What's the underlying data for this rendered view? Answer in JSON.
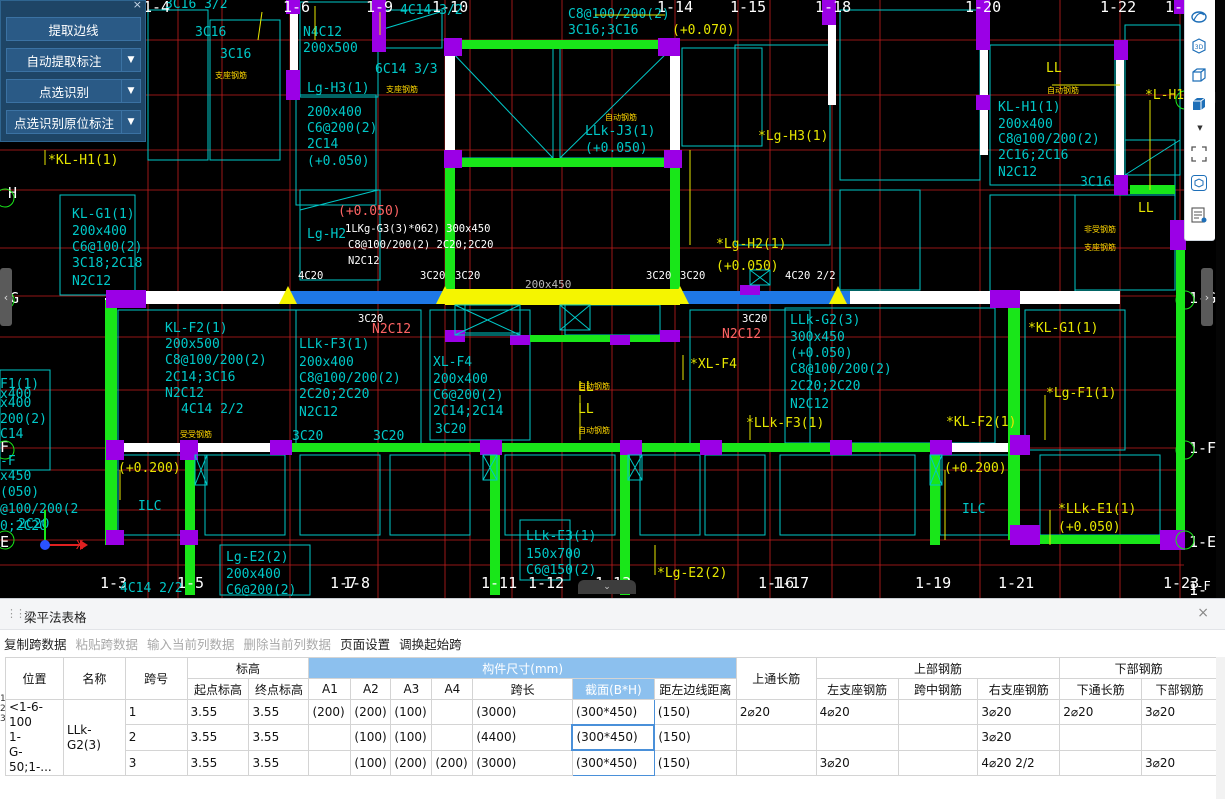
{
  "left_panel": {
    "close_glyph": "×",
    "buttons": [
      {
        "label": "提取边线",
        "has_dropdown": false
      },
      {
        "label": "自动提取标注",
        "has_dropdown": true
      },
      {
        "label": "点选识别",
        "has_dropdown": true
      },
      {
        "label": "点选识别原位标注",
        "has_dropdown": true
      }
    ]
  },
  "right_toolbar": {
    "icons": [
      "orbit-icon",
      "3d-view-icon",
      "cube-view-icon",
      "solid-view-icon",
      "fullscreen-icon",
      "box-select-icon",
      "layer-settings-icon"
    ],
    "label_3d": "3D"
  },
  "cad": {
    "axis_labels_top": [
      "1-4",
      "1-6",
      "1-9",
      "1-10",
      "1-14",
      "1-15",
      "1-18",
      "1-20",
      "1-22",
      "1-24"
    ],
    "axis_labels_bottom": [
      "1-3",
      "1-5",
      "1-7",
      "1-8",
      "1-11",
      "1-12",
      "1-13",
      "1-16",
      "1-17",
      "1-19",
      "1-21",
      "1-23"
    ],
    "axis_labels_side": [
      "H",
      "G",
      "F",
      "E",
      "1-H",
      "1-G",
      "1-F",
      "1-E",
      "1-"
    ],
    "texts": {
      "t1": "3C16 3/2",
      "t2": "3C16",
      "t3": "3C16",
      "t4": "N4C12",
      "t5": "200x500",
      "t6": "4C14 3/2",
      "t7": "C8@100/200(2)",
      "t8": "3C16;3C16",
      "t9": "(+0.070)",
      "t10": "Lg-H3(1)",
      "t11": "200x400",
      "t12": "C6@200(2)",
      "t13": "2C14",
      "t14": "(+0.050)",
      "t15": "6C14 3/3",
      "t16": "LLk-J3(1)",
      "t17": "(+0.050)",
      "t18": "*Lg-H3(1)",
      "t19": "KL-H1(1)",
      "t20": "200x400",
      "t21": "C8@100/200(2)",
      "t22": "2C16;2C16",
      "t23": "N2C12",
      "t24": "LL",
      "t25": "3C16",
      "t26": "LL",
      "t27": "*L-H1(",
      "t28": "*KL-H1(1)",
      "t29": "KL-G1(1)",
      "t30": "200x400",
      "t31": "C6@100(2)",
      "t32": "3C18;2C18",
      "t33": "N2C12",
      "t34": "(+0.050)",
      "t35": "Lg-H2",
      "t36": "1LKg-G3(3)*062) 300x450",
      "t37": "C8@100/200(2) 2C20;2C20",
      "t38": "N2C12",
      "t39": "*Lg-H2(1)",
      "t40": "(+0.050)",
      "t41": "4C20",
      "t42": "3C20",
      "t43": "3C20",
      "t44": "3C20",
      "t45": "3C20",
      "t46": "200x450",
      "t47": "4C20 2/2",
      "t48": "3C20",
      "t49": "N2C12",
      "t50": "3C20",
      "t51": "N2C12",
      "t52": "LLk-G2(3)",
      "t53": "300x450",
      "t54": "(+0.050)",
      "t55": "C8@100/200(2)",
      "t56": "2C20;2C20",
      "t57": "N2C12",
      "t58": "*KL-G1(1)",
      "t59": "KL-F2(1)",
      "t60": "200x500",
      "t61": "C8@100/200(2)",
      "t62": "2C14;3C16",
      "t63": "N2C12",
      "t64": "4C14 2/2",
      "t65": "LLk-F3(1)",
      "t66": "200x400",
      "t67": "C8@100/200(2)",
      "t68": "2C20;2C20",
      "t69": "N2C12",
      "t70": "XL-F4",
      "t71": "200x400",
      "t72": "C6@200(2)",
      "t73": "2C14;2C14",
      "t74": "3C20",
      "t75": "*XL-F4",
      "t76": "LL",
      "t77": "LL",
      "t78": "*LLk-F3(1)",
      "t79": "*KL-F2(1)",
      "t80": "*Lg-F1(1)",
      "t81": "3C20",
      "t82": "3C20",
      "t83": "F1(1)",
      "t84": "x400",
      "t85": "200(2)",
      "t86": "C14",
      "t87": "1-F",
      "t88": "(+0.200)",
      "t89": "ILC",
      "t90": "(+0.200)",
      "t91": "ILC",
      "t92": "*LLk-E1(1)",
      "t93": "(+0.050)",
      "t94": "Lg-E2(2)",
      "t95": "200x400",
      "t96": "C6@200(2)",
      "t97": "LLk-E3(1)",
      "t98": "150x700",
      "t99": "C6@150(2)",
      "t100": "*Lg-E2(2)",
      "t101": "4C14 2/2",
      "t102": "x450",
      "t103": "(050)",
      "t104": "@100/200(2",
      "t105": "2C20",
      "t106": "0;2C20",
      "t107": "-F",
      "t108": "x400",
      "t109": "X"
    },
    "notes_yellow": [
      "支座钢筋",
      "支座钢筋",
      "自动钢筋",
      "非受钢筋",
      "自动钢筋",
      "自动钢筋",
      "受受钢筋",
      "自动钢筋",
      "支座钢筋"
    ]
  },
  "table_panel": {
    "title": "梁平法表格",
    "close_glyph": "×",
    "toolbar": [
      {
        "label": "复制跨数据",
        "enabled": true
      },
      {
        "label": "粘贴跨数据",
        "enabled": false
      },
      {
        "label": "输入当前列数据",
        "enabled": false
      },
      {
        "label": "删除当前列数据",
        "enabled": false
      },
      {
        "label": "页面设置",
        "enabled": true
      },
      {
        "label": "调换起始跨",
        "enabled": true
      }
    ],
    "headers": {
      "position": "位置",
      "name": "名称",
      "span_no": "跨号",
      "elevation": "标高",
      "elev_start": "起点标高",
      "elev_end": "终点标高",
      "dims": "构件尺寸(mm)",
      "a1": "A1",
      "a2": "A2",
      "a3": "A3",
      "a4": "A4",
      "span_len": "跨长",
      "section": "截面(B*H)",
      "edge_dist": "距左边线距离",
      "top_through": "上通长筋",
      "top_rebar": "上部钢筋",
      "left_support": "左支座钢筋",
      "mid_span": "跨中钢筋",
      "right_support": "右支座钢筋",
      "bottom_rebar": "下部钢筋",
      "bottom_through": "下通长筋",
      "bottom_rebar2": "下部钢筋"
    },
    "position_value": "<1-6-100\n1-\nG-50;1-...",
    "name_value": "LLk-\nG2(3)",
    "rows": [
      {
        "span": "1",
        "elev_start": "3.55",
        "elev_end": "3.55",
        "a1": "(200)",
        "a2": "(200)",
        "a3": "(100)",
        "a4": "",
        "span_len": "(3000)",
        "section": "(300*450)",
        "edge": "(150)",
        "top_through": "2⌀20",
        "left": "4⌀20",
        "mid": "",
        "right": "3⌀20",
        "bot_through": "2⌀20",
        "bot": "3⌀20"
      },
      {
        "span": "2",
        "elev_start": "3.55",
        "elev_end": "3.55",
        "a1": "",
        "a2": "(100)",
        "a3": "(100)",
        "a4": "",
        "span_len": "(4400)",
        "section": "(300*450)",
        "edge": "(150)",
        "top_through": "",
        "left": "",
        "mid": "",
        "right": "3⌀20",
        "bot_through": "",
        "bot": ""
      },
      {
        "span": "3",
        "elev_start": "3.55",
        "elev_end": "3.55",
        "a1": "",
        "a2": "(100)",
        "a3": "(200)",
        "a4": "(200)",
        "span_len": "(3000)",
        "section": "(300*450)",
        "edge": "(150)",
        "top_through": "",
        "left": "3⌀20",
        "mid": "",
        "right": "4⌀20 2/2",
        "bot_through": "",
        "bot": "3⌀20"
      }
    ],
    "left_marks": [
      "1",
      "2",
      "3"
    ]
  },
  "colors": {
    "cad_bg": "#000000",
    "grid_red": "#c41e1e",
    "axis_white": "#ffffff",
    "beam_cyan": "#00c8c8",
    "wall_green": "#19e619",
    "column_purple": "#9b00e6",
    "selected_blue": "#1e78e6",
    "selected_yellow": "#f5f500",
    "panel_blue": "#1e4566",
    "header_highlight": "#8cc0ee"
  }
}
